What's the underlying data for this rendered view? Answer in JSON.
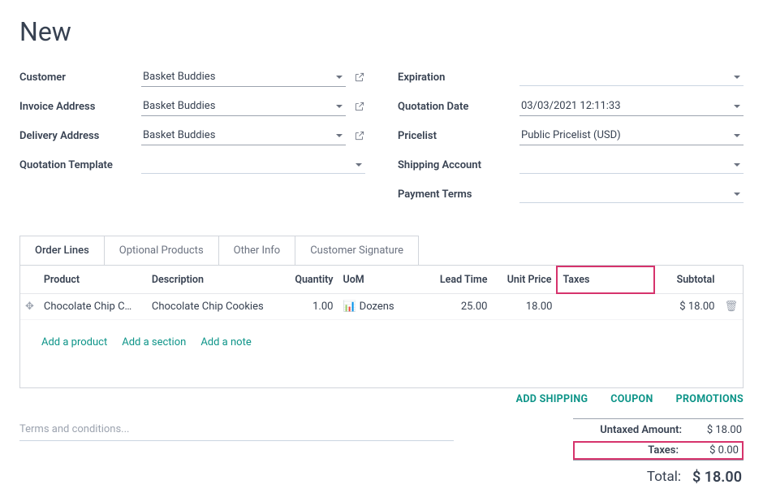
{
  "page_title": "New",
  "fields": {
    "customer": {
      "label": "Customer",
      "value": "Basket Buddies"
    },
    "invoice_address": {
      "label": "Invoice Address",
      "value": "Basket Buddies"
    },
    "delivery_address": {
      "label": "Delivery Address",
      "value": "Basket Buddies"
    },
    "quotation_template": {
      "label": "Quotation Template",
      "value": ""
    },
    "expiration": {
      "label": "Expiration",
      "value": ""
    },
    "quotation_date": {
      "label": "Quotation Date",
      "value": "03/03/2021 12:11:33"
    },
    "pricelist": {
      "label": "Pricelist",
      "value": "Public Pricelist (USD)"
    },
    "shipping_account": {
      "label": "Shipping Account",
      "value": ""
    },
    "payment_terms": {
      "label": "Payment Terms",
      "value": ""
    }
  },
  "tabs": [
    "Order Lines",
    "Optional Products",
    "Other Info",
    "Customer Signature"
  ],
  "columns": {
    "product": "Product",
    "description": "Description",
    "quantity": "Quantity",
    "uom": "UoM",
    "lead_time": "Lead Time",
    "unit_price": "Unit Price",
    "taxes": "Taxes",
    "subtotal": "Subtotal"
  },
  "lines": [
    {
      "product": "Chocolate Chip C…",
      "description": "Chocolate Chip Cookies",
      "quantity": "1.00",
      "uom": "Dozens",
      "lead_time": "25.00",
      "unit_price": "18.00",
      "taxes": "",
      "subtotal": "$ 18.00"
    }
  ],
  "row_actions": {
    "add_product": "Add a product",
    "add_section": "Add a section",
    "add_note": "Add a note"
  },
  "bottom_links": {
    "add_shipping": "ADD SHIPPING",
    "coupon": "COUPON",
    "promotions": "PROMOTIONS"
  },
  "terms_placeholder": "Terms and conditions...",
  "totals": {
    "untaxed_label": "Untaxed Amount:",
    "untaxed_value": "$ 18.00",
    "taxes_label": "Taxes:",
    "taxes_value": "$ 0.00",
    "total_label": "Total:",
    "total_value": "$ 18.00"
  }
}
